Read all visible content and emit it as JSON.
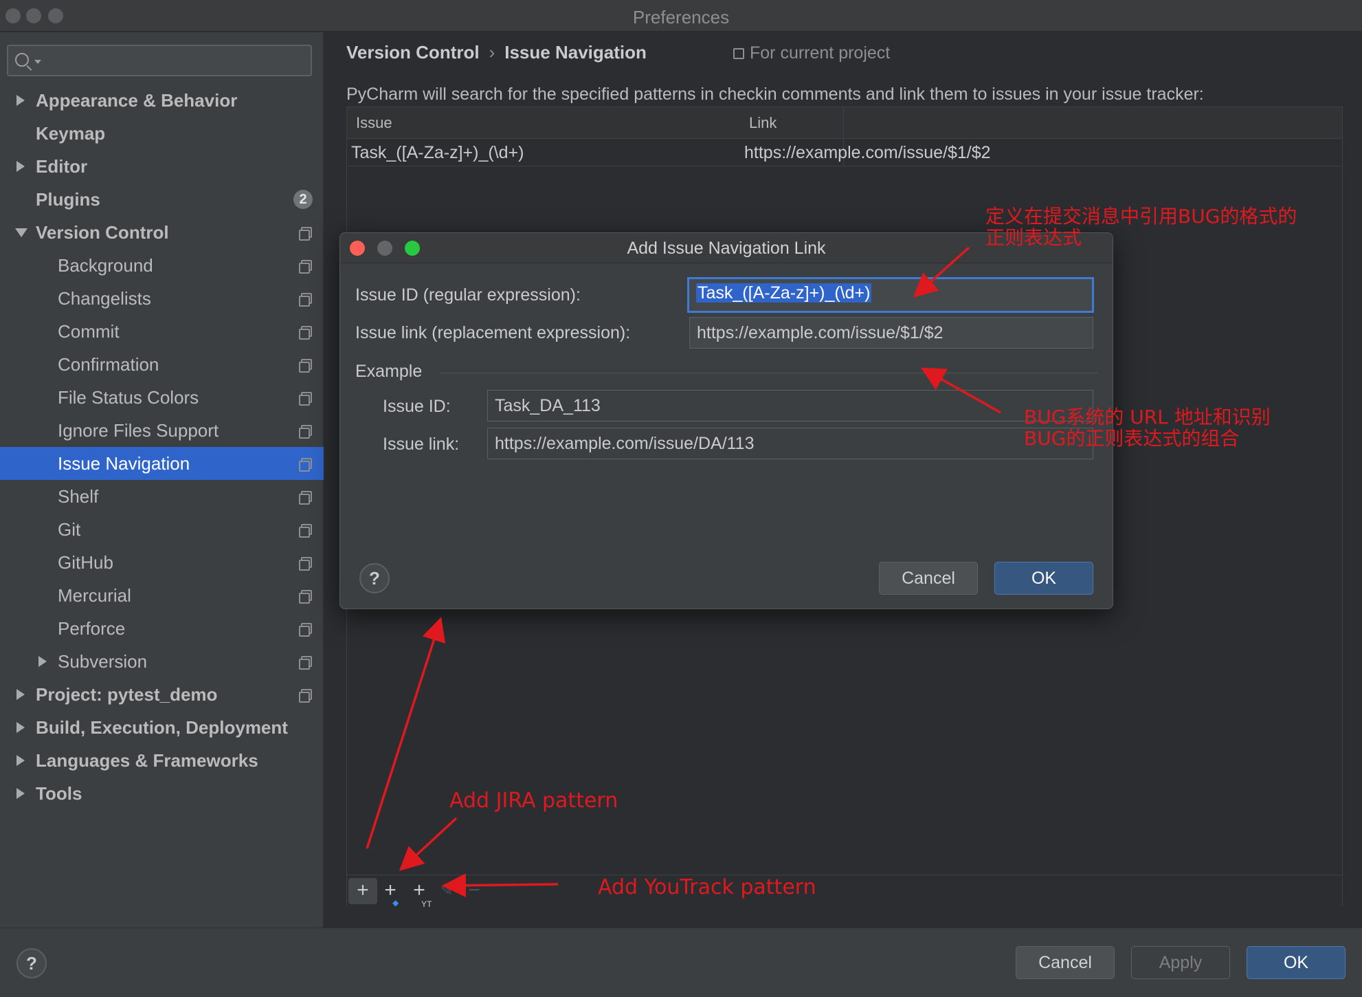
{
  "window": {
    "title": "Preferences"
  },
  "search": {
    "placeholder": ""
  },
  "sidebar": {
    "items": [
      {
        "label": "Appearance & Behavior",
        "level": 0,
        "expander": "collapsed",
        "project_icon": false
      },
      {
        "label": "Keymap",
        "level": 0,
        "expander": "none",
        "project_icon": false
      },
      {
        "label": "Editor",
        "level": 0,
        "expander": "collapsed",
        "project_icon": false
      },
      {
        "label": "Plugins",
        "level": 0,
        "expander": "none",
        "badge": "2",
        "project_icon": false
      },
      {
        "label": "Version Control",
        "level": 0,
        "expander": "expanded",
        "project_icon": true
      },
      {
        "label": "Background",
        "level": 1,
        "expander": "none",
        "project_icon": true
      },
      {
        "label": "Changelists",
        "level": 1,
        "expander": "none",
        "project_icon": true
      },
      {
        "label": "Commit",
        "level": 1,
        "expander": "none",
        "project_icon": true
      },
      {
        "label": "Confirmation",
        "level": 1,
        "expander": "none",
        "project_icon": true
      },
      {
        "label": "File Status Colors",
        "level": 1,
        "expander": "none",
        "project_icon": true
      },
      {
        "label": "Ignore Files Support",
        "level": 1,
        "expander": "none",
        "project_icon": true
      },
      {
        "label": "Issue Navigation",
        "level": 1,
        "expander": "none",
        "project_icon": true,
        "selected": true
      },
      {
        "label": "Shelf",
        "level": 1,
        "expander": "none",
        "project_icon": true
      },
      {
        "label": "Git",
        "level": 1,
        "expander": "none",
        "project_icon": true
      },
      {
        "label": "GitHub",
        "level": 1,
        "expander": "none",
        "project_icon": true
      },
      {
        "label": "Mercurial",
        "level": 1,
        "expander": "none",
        "project_icon": true
      },
      {
        "label": "Perforce",
        "level": 1,
        "expander": "none",
        "project_icon": true
      },
      {
        "label": "Subversion",
        "level": 1,
        "expander": "collapsed",
        "project_icon": true
      },
      {
        "label": "Project: pytest_demo",
        "level": 0,
        "expander": "collapsed",
        "project_icon": true
      },
      {
        "label": "Build, Execution, Deployment",
        "level": 0,
        "expander": "collapsed",
        "project_icon": false
      },
      {
        "label": "Languages & Frameworks",
        "level": 0,
        "expander": "collapsed",
        "project_icon": false
      },
      {
        "label": "Tools",
        "level": 0,
        "expander": "collapsed",
        "project_icon": false
      }
    ]
  },
  "main": {
    "breadcrumb": [
      "Version Control",
      "Issue Navigation"
    ],
    "breadcrumb_separator": "›",
    "scope_label": "For current project",
    "description": "PyCharm will search for the specified patterns in checkin comments and link them to issues in your issue tracker:",
    "table": {
      "columns": [
        "Issue",
        "Link"
      ],
      "rows": [
        [
          "Task_([A-Za-z]+)_(\\d+)",
          "https://example.com/issue/$1/$2"
        ]
      ]
    },
    "toolbar": {
      "add_icon": "plus-icon",
      "add_jira_icon": "plus-jira-icon",
      "add_youtrack_icon": "plus-youtrack-icon",
      "add_youtrack_suffix": "YT",
      "edit_icon": "pencil-icon",
      "remove_icon": "minus-icon"
    }
  },
  "dialog": {
    "title": "Add Issue Navigation Link",
    "issue_id_label": "Issue ID (regular expression):",
    "issue_id_value": "Task_([A-Za-z]+)_(\\d+)",
    "issue_link_label": "Issue link (replacement expression):",
    "issue_link_value": "https://example.com/issue/$1/$2",
    "example_section": "Example",
    "example_id_label": "Issue ID:",
    "example_id_value": "Task_DA_113",
    "example_link_label": "Issue link:",
    "example_link_value": "https://example.com/issue/DA/113",
    "help": "?",
    "cancel": "Cancel",
    "ok": "OK"
  },
  "footer": {
    "help": "?",
    "cancel": "Cancel",
    "apply": "Apply",
    "ok": "OK"
  },
  "annotations": {
    "regex_note_line1": "定义在提交消息中引用BUG的格式的",
    "regex_note_line2": "正则表达式",
    "url_note_line1": "BUG系统的 URL 地址和识别",
    "url_note_line2": "BUG的正则表达式的组合",
    "jira": "Add JIRA pattern",
    "youtrack": "Add YouTrack pattern"
  },
  "colors": {
    "accent": "#2f65ca",
    "annotation": "#e0191f",
    "traffic_close": "#fe5f57",
    "traffic_min": "#636568",
    "traffic_max": "#28c840"
  }
}
